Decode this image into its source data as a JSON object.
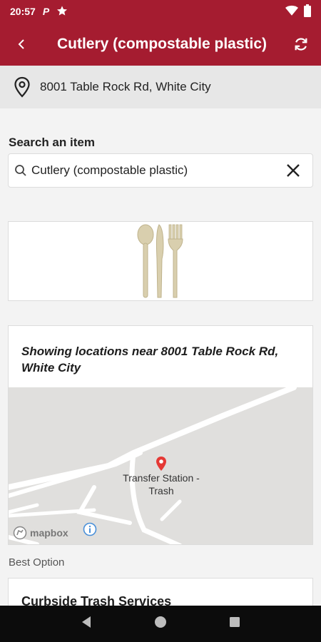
{
  "status_bar": {
    "time": "20:57",
    "notif_letter": "P"
  },
  "app_bar": {
    "title": "Cutlery (compostable plastic)"
  },
  "address": {
    "text": "8001 Table Rock Rd, White City"
  },
  "search": {
    "label": "Search an item",
    "value": "Cutlery (compostable plastic)"
  },
  "locations": {
    "heading": "Showing locations near 8001 Table Rock Rd, White City",
    "marker_label": "Transfer Station - Trash",
    "attribution": "mapbox"
  },
  "best_option": {
    "label": "Best Option",
    "title": "Curbside Trash Services"
  },
  "colors": {
    "brand": "#a51c30",
    "marker": "#e53935"
  }
}
